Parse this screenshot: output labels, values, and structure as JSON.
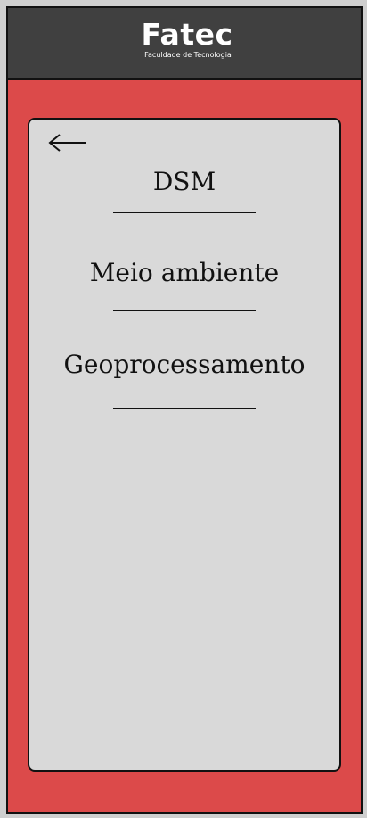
{
  "header": {
    "logo_title": "Fatec",
    "logo_subtitle": "Faculdade de Tecnologia"
  },
  "card": {
    "back_icon": "arrow-left-icon",
    "items": [
      {
        "label": "DSM"
      },
      {
        "label": "Meio ambiente"
      },
      {
        "label": "Geoprocessamento"
      }
    ]
  },
  "colors": {
    "page_background": "#cfcfcf",
    "header_background": "#404040",
    "accent_red": "#dc4a4a",
    "card_background": "#d9d9d9",
    "text": "#111111",
    "logo_text": "#ffffff"
  }
}
